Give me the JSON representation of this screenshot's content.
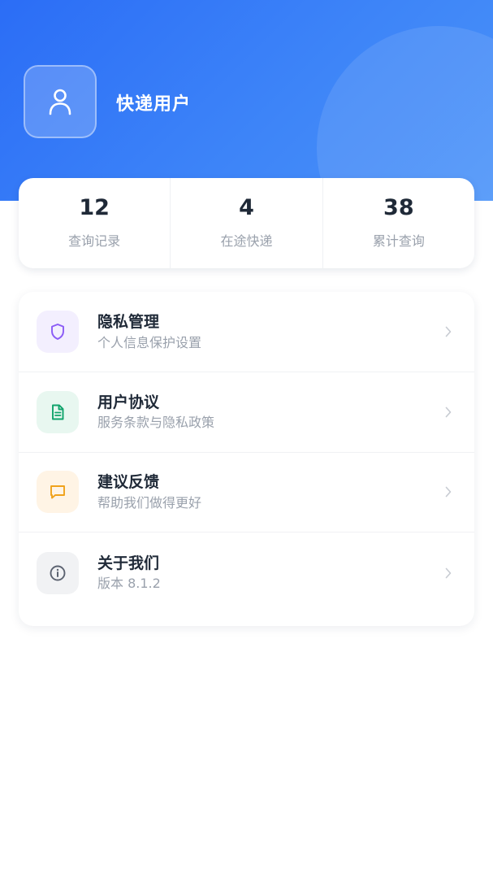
{
  "header": {
    "username": "快递用户"
  },
  "stats": [
    {
      "value": "12",
      "label": "查询记录"
    },
    {
      "value": "4",
      "label": "在途快递"
    },
    {
      "value": "38",
      "label": "累计查询"
    }
  ],
  "menu": {
    "items": [
      {
        "title": "隐私管理",
        "subtitle": "个人信息保护设置",
        "icon": "shield-icon",
        "icon_color": "#8b5cf6",
        "icon_bg": "#f3effe"
      },
      {
        "title": "用户协议",
        "subtitle": "服务条款与隐私政策",
        "icon": "document-icon",
        "icon_color": "#10a36b",
        "icon_bg": "#e8f7f0"
      },
      {
        "title": "建议反馈",
        "subtitle": "帮助我们做得更好",
        "icon": "message-icon",
        "icon_color": "#f0a21b",
        "icon_bg": "#fff4e5"
      },
      {
        "title": "关于我们",
        "subtitle": "版本 8.1.2",
        "icon": "info-icon",
        "icon_color": "#5b6270",
        "icon_bg": "#f1f2f4"
      }
    ]
  },
  "colors": {
    "header_start": "#2b6df6",
    "header_end": "#4b93f9",
    "text_primary": "#1f2937",
    "text_secondary": "#9aa1ac"
  }
}
